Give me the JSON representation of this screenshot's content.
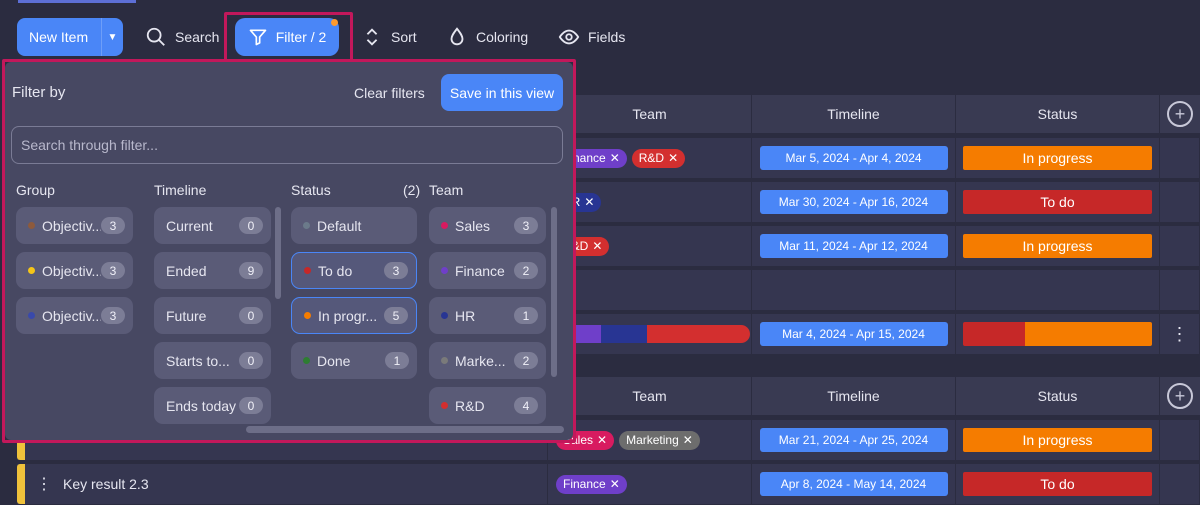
{
  "toolbar": {
    "new_item": "New Item",
    "search": "Search",
    "filter": "Filter / 2",
    "sort": "Sort",
    "coloring": "Coloring",
    "fields": "Fields"
  },
  "table": {
    "headers": {
      "team": "Team",
      "timeline": "Timeline",
      "status": "Status"
    },
    "rows": [
      {
        "tags": [
          {
            "label": "Finance",
            "color": "#6f3fc9"
          },
          {
            "label": "R&D",
            "color": "#d32f2f"
          }
        ],
        "timeline": "Mar 5, 2024 - Apr 4, 2024",
        "status": "In progress",
        "status_color": "#f57c00"
      },
      {
        "tags": [
          {
            "label": "HR",
            "color": "#283593"
          }
        ],
        "timeline": "Mar 30, 2024 - Apr 16, 2024",
        "status": "To do",
        "status_color": "#c62828"
      },
      {
        "tags": [
          {
            "label": "R&D",
            "color": "#d32f2f"
          }
        ],
        "timeline": "Mar 11, 2024 - Apr 12, 2024",
        "status": "In progress",
        "status_color": "#f57c00"
      },
      {
        "tags": [],
        "timeline": "",
        "status": "",
        "status_color": ""
      },
      {
        "tags": [],
        "timeline": "Mar 4, 2024 - Apr 15, 2024",
        "status": "",
        "status_color": ""
      }
    ],
    "rows2": [
      {
        "tags": [
          {
            "label": "Sales",
            "color": "#d81b60"
          },
          {
            "label": "Marketing",
            "color": "#6d6d6d"
          }
        ],
        "timeline": "Mar 21, 2024 - Apr 25, 2024",
        "status": "In progress",
        "status_color": "#f57c00"
      },
      {
        "name": "Key result 2.3",
        "tags": [
          {
            "label": "Finance",
            "color": "#6f3fc9"
          }
        ],
        "timeline": "Apr 8, 2024 - May 14, 2024",
        "status": "To do",
        "status_color": "#c62828"
      }
    ]
  },
  "filter_panel": {
    "title": "Filter by",
    "clear": "Clear filters",
    "save": "Save in this view",
    "search_placeholder": "Search through filter...",
    "columns": {
      "group": {
        "title": "Group",
        "items": [
          {
            "label": "Objectiv...",
            "count": "3",
            "dot": "#8d5a3c"
          },
          {
            "label": "Objectiv...",
            "count": "3",
            "dot": "#f5c518"
          },
          {
            "label": "Objectiv...",
            "count": "3",
            "dot": "#3949ab"
          }
        ]
      },
      "timeline": {
        "title": "Timeline",
        "items": [
          {
            "label": "Current",
            "count": "0"
          },
          {
            "label": "Ended",
            "count": "9"
          },
          {
            "label": "Future",
            "count": "0"
          },
          {
            "label": "Starts to...",
            "count": "0"
          },
          {
            "label": "Ends today",
            "count": "0"
          }
        ]
      },
      "status": {
        "title": "Status",
        "selected_count": "(2)",
        "items": [
          {
            "label": "Default",
            "count": "",
            "dot": "#6b7a8a"
          },
          {
            "label": "To do",
            "count": "3",
            "dot": "#c62828"
          },
          {
            "label": "In progr...",
            "count": "5",
            "dot": "#f57c00"
          },
          {
            "label": "Done",
            "count": "1",
            "dot": "#2e7d32"
          }
        ]
      },
      "team": {
        "title": "Team",
        "items": [
          {
            "label": "Sales",
            "count": "3",
            "dot": "#d81b60"
          },
          {
            "label": "Finance",
            "count": "2",
            "dot": "#6f3fc9"
          },
          {
            "label": "HR",
            "count": "1",
            "dot": "#283593"
          },
          {
            "label": "Marke...",
            "count": "2",
            "dot": "#7a7a7a"
          },
          {
            "label": "R&D",
            "count": "4",
            "dot": "#d32f2f"
          }
        ]
      }
    }
  }
}
